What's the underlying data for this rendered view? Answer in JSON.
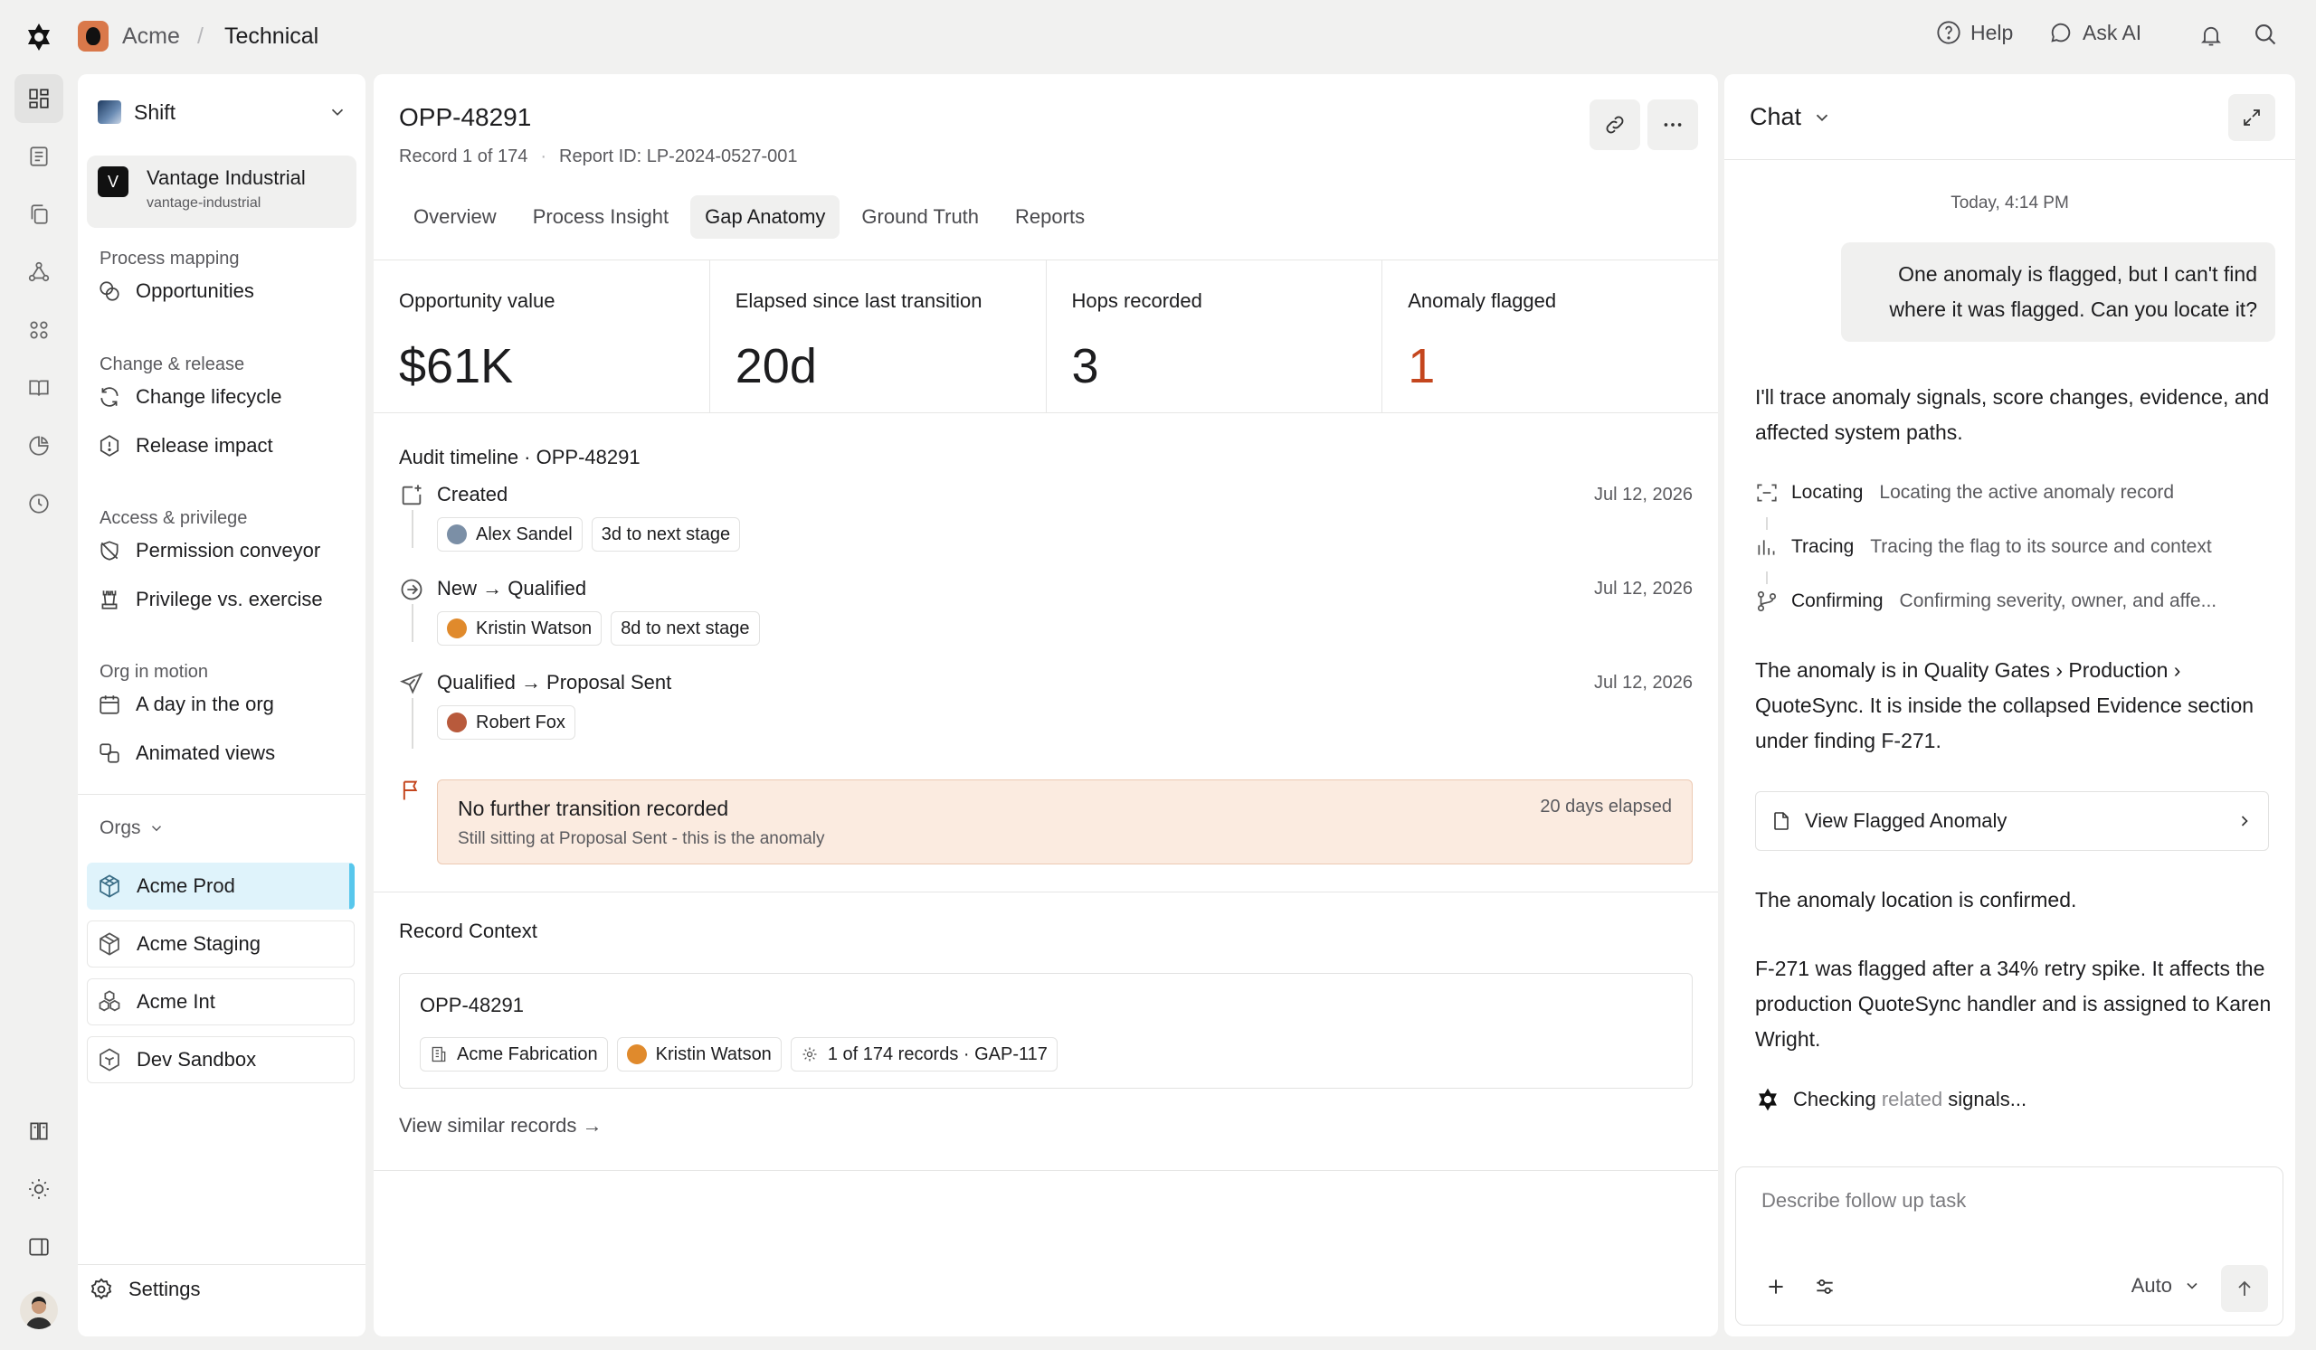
{
  "topbar": {
    "org": "Acme",
    "separator": "/",
    "page": "Technical",
    "help": "Help",
    "ask_ai": "Ask AI"
  },
  "sidebar": {
    "workspace": "Shift",
    "tenant": {
      "badge": "V",
      "name": "Vantage Industrial",
      "slug": "vantage-industrial"
    },
    "sections": [
      {
        "title": "Process mapping",
        "items": [
          {
            "label": "Opportunities",
            "icon": "opportunities-icon"
          }
        ]
      },
      {
        "title": "Change & release",
        "items": [
          {
            "label": "Change lifecycle",
            "icon": "refresh-icon"
          },
          {
            "label": "Release impact",
            "icon": "hexagon-alert-icon"
          }
        ]
      },
      {
        "title": "Access & privilege",
        "items": [
          {
            "label": "Permission conveyor",
            "icon": "shield-off-icon"
          },
          {
            "label": "Privilege vs. exercise",
            "icon": "chess-rook-icon"
          }
        ]
      },
      {
        "title": "Org in motion",
        "items": [
          {
            "label": "A day in the org",
            "icon": "calendar-icon"
          },
          {
            "label": "Animated views",
            "icon": "shapes-icon"
          }
        ]
      }
    ],
    "orgs_title": "Orgs",
    "orgs": [
      {
        "label": "Acme Prod",
        "active": true
      },
      {
        "label": "Acme Staging",
        "active": false
      },
      {
        "label": "Acme Int",
        "active": false
      },
      {
        "label": "Dev Sandbox",
        "active": false
      }
    ],
    "settings": "Settings"
  },
  "main": {
    "title": "OPP-48291",
    "record_pos": "Record 1 of 174",
    "report_id": "Report ID: LP-2024-0527-001",
    "tabs": [
      "Overview",
      "Process Insight",
      "Gap Anatomy",
      "Ground Truth",
      "Reports"
    ],
    "active_tab": "Gap Anatomy",
    "metrics": [
      {
        "label": "Opportunity value",
        "value": "$61K"
      },
      {
        "label": "Elapsed since last transition",
        "value": "20d"
      },
      {
        "label": "Hops recorded",
        "value": "3"
      },
      {
        "label": "Anomaly flagged",
        "value": "1"
      }
    ],
    "audit_title": "Audit timeline · OPP-48291",
    "timeline": [
      {
        "title": "Created",
        "date": "Jul 12, 2026",
        "person": "Alex Sandel",
        "next": "3d to next stage"
      },
      {
        "title": "New → Qualified",
        "date": "Jul 12, 2026",
        "person": "Kristin Watson",
        "next": "8d to next stage"
      },
      {
        "title": "Qualified → Proposal Sent",
        "date": "Jul 12, 2026",
        "person": "Robert Fox"
      }
    ],
    "anomaly": {
      "title": "No further transition recorded",
      "subtitle": "Still sitting at Proposal Sent - this is the anomaly",
      "elapsed": "20 days elapsed"
    },
    "context": {
      "title": "Record Context",
      "id": "OPP-48291",
      "company": "Acme Fabrication",
      "owner": "Kristin Watson",
      "records": "1 of 174 records · GAP-117",
      "link": "View similar records →"
    }
  },
  "chat": {
    "title": "Chat",
    "timestamp": "Today, 4:14 PM",
    "user_message": "One anomaly is flagged, but I can't find where it was flagged. Can you locate it?",
    "intro": "I'll trace anomaly signals, score changes, evidence, and affected system paths.",
    "steps": [
      {
        "name": "Locating",
        "desc": "Locating the active anomaly record"
      },
      {
        "name": "Tracing",
        "desc": "Tracing the flag to its source and context"
      },
      {
        "name": "Confirming",
        "desc": "Confirming severity, owner, and affe..."
      }
    ],
    "location_text": "The anomaly is in Quality Gates › Production › QuoteSync. It is inside the collapsed Evidence section under finding F-271.",
    "flag_card": "View Flagged Anomaly",
    "confirmed": "The anomaly location is confirmed.",
    "detail": "F-271 was flagged after a 34% retry spike. It affects the production QuoteSync handler and is assigned to Karen Wright.",
    "thinking_a": "Checking ",
    "thinking_b": "related",
    "thinking_c": " signals...",
    "composer_placeholder": "Describe follow up task",
    "model": "Auto"
  },
  "colors": {
    "accent_blue": "#58c7ec",
    "anomaly_orange": "#c4461e",
    "anomaly_bg": "#fbebe0"
  }
}
